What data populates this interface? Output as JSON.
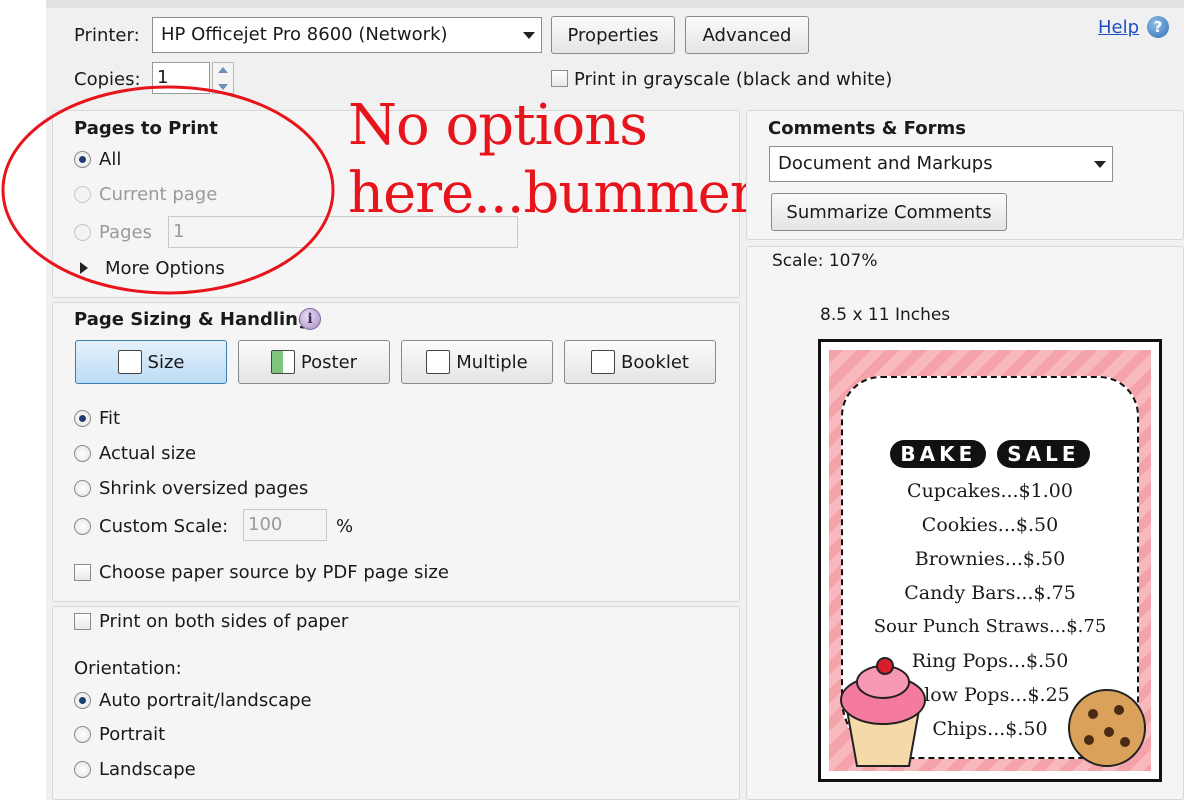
{
  "printer": {
    "label": "Printer:",
    "value": "HP Officejet Pro 8600 (Network)",
    "properties_label": "Properties",
    "advanced_label": "Advanced",
    "help_label": "Help"
  },
  "copies": {
    "label": "Copies:",
    "value": "1",
    "grayscale_label": "Print in grayscale (black and white)"
  },
  "pages_to_print": {
    "title": "Pages to Print",
    "all_label": "All",
    "current_page_label": "Current page",
    "pages_label": "Pages",
    "pages_value": "1",
    "more_options_label": "More Options"
  },
  "annotation": {
    "line1": "No options",
    "line2": "here...bummer!",
    "color": "#e8141b"
  },
  "comments_forms": {
    "title": "Comments & Forms",
    "value": "Document and Markups",
    "summarize_label": "Summarize Comments"
  },
  "preview": {
    "scale_label": "Scale: 107%",
    "size_label": "8.5 x 11 Inches",
    "flyer": {
      "title_word1": "BAKE",
      "title_word2": "SALE",
      "items": [
        "Cupcakes...$1.00",
        "Cookies...$.50",
        "Brownies...$.50",
        "Candy Bars...$.75",
        "Sour Punch Straws...$.75",
        "Ring Pops...$.50",
        "Blow Pops...$.25",
        "Chips...$.50"
      ]
    }
  },
  "page_sizing": {
    "title": "Page Sizing & Handling",
    "size_label": "Size",
    "poster_label": "Poster",
    "multiple_label": "Multiple",
    "booklet_label": "Booklet",
    "fit_label": "Fit",
    "actual_size_label": "Actual size",
    "shrink_label": "Shrink oversized pages",
    "custom_scale_label": "Custom Scale:",
    "custom_scale_value": "100",
    "percent_label": "%",
    "paper_source_label": "Choose paper source by PDF page size"
  },
  "duplex": {
    "both_sides_label": "Print on both sides of paper"
  },
  "orientation": {
    "label": "Orientation:",
    "auto_label": "Auto portrait/landscape",
    "portrait_label": "Portrait",
    "landscape_label": "Landscape"
  }
}
